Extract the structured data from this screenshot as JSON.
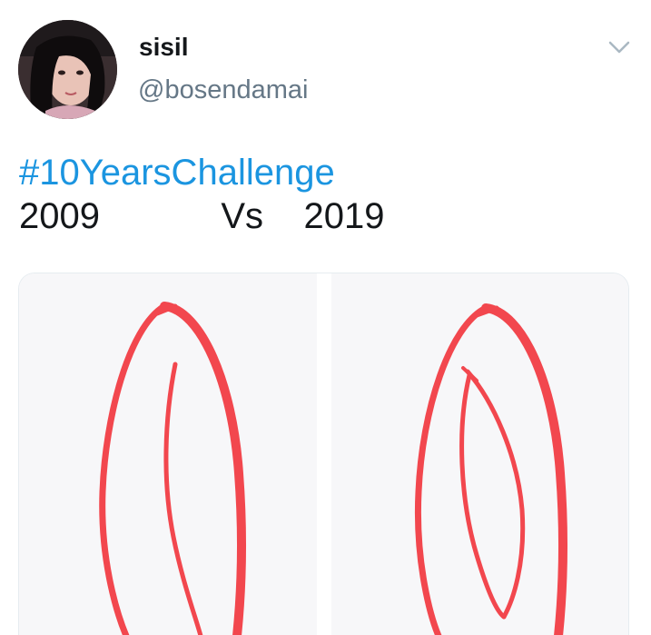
{
  "tweet": {
    "display_name": "sisil",
    "handle": "@bosendamai",
    "hashtag": "#10YearsChallenge",
    "line2": "2009            Vs    2019"
  },
  "media": {
    "stroke_color": "#f2474e",
    "background": "#f7f7f9"
  },
  "colors": {
    "link": "#1b95e0",
    "secondary": "#657786",
    "text": "#14171a"
  },
  "icons": {
    "menu": "chevron-down-icon"
  }
}
